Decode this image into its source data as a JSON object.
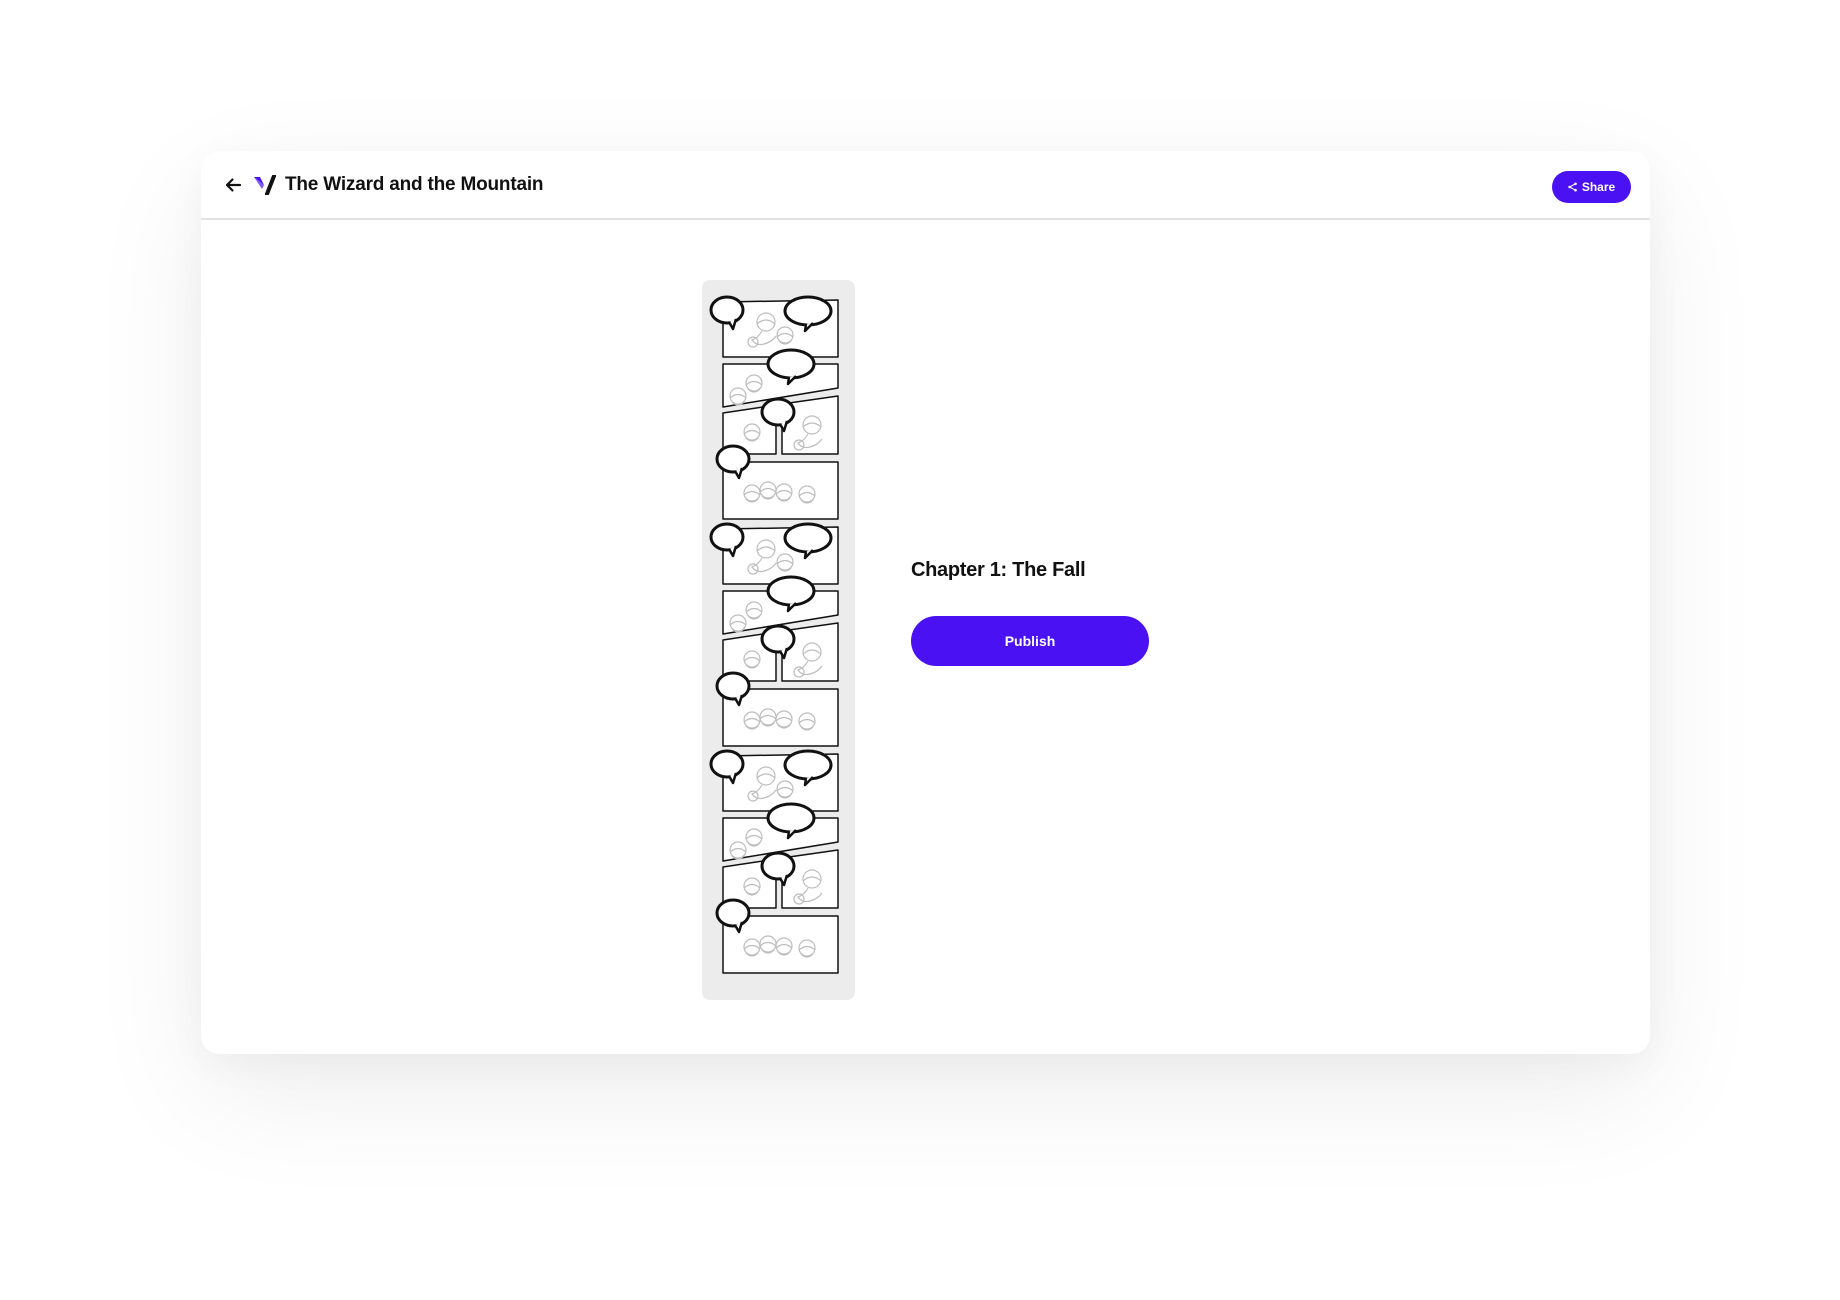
{
  "app": {
    "accent_color": "#4a12f2",
    "logo_icon": "brand-logo-icon"
  },
  "header": {
    "back_icon": "arrow-left-icon",
    "title": "The Wizard and the Mountain",
    "share_label": "Share",
    "share_icon": "share-icon"
  },
  "chapter": {
    "title": "Chapter 1: The Fall",
    "publish_label": "Publish",
    "thumbnail_icon": "comic-page-thumbnail"
  }
}
